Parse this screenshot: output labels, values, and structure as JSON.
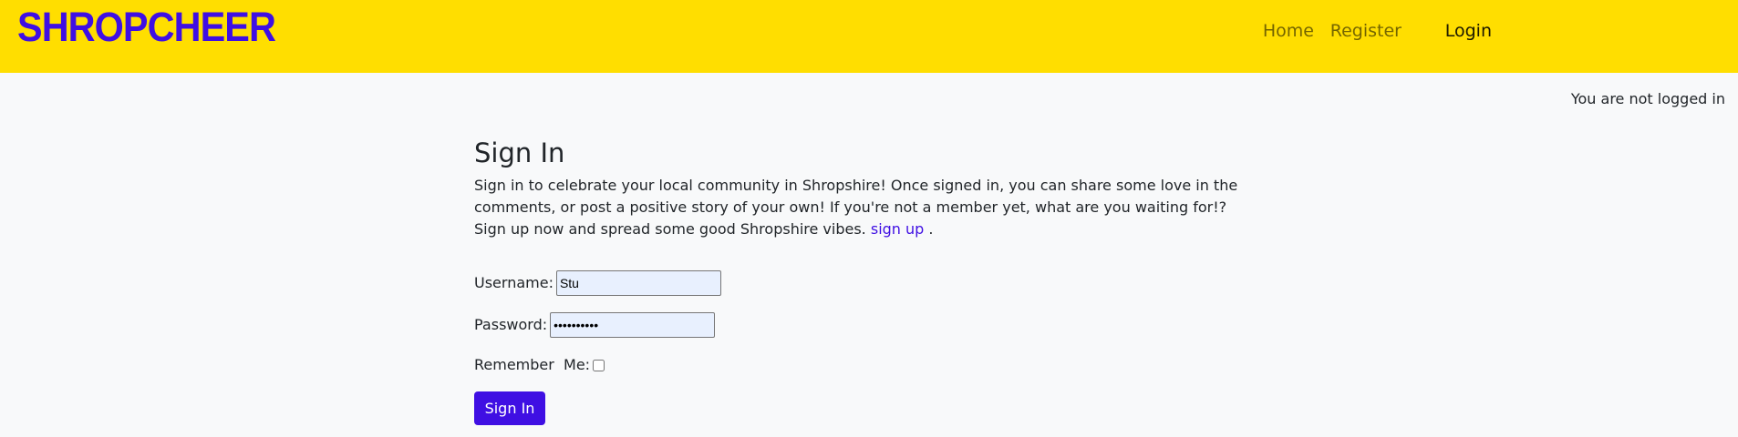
{
  "navbar": {
    "brand": "SHROPCHEER",
    "links": [
      {
        "label": "Home"
      },
      {
        "label": "Register"
      },
      {
        "label": "Login"
      }
    ]
  },
  "status_text": "You are not logged in",
  "signin": {
    "title": "Sign In",
    "intro_text": "Sign in to celebrate your local community in Shropshire! Once signed in, you can share some love in the comments, or post a positive story of your own!  If you're not a member yet, what are you waiting for!? Sign up now and spread some good Shropshire vibes.",
    "signup_link": "sign up",
    "signup_suffix": ".",
    "username_label": "Username:",
    "username_value": "Stu",
    "password_label": "Password:",
    "password_value": "••••••••••",
    "remember_label": "Remember  Me:",
    "submit_label": "Sign In"
  },
  "colors": {
    "navbar_bg": "#ffde00",
    "brand": "#3f0fe3",
    "button_bg": "#3f0fe3",
    "page_bg": "#f8f9fa"
  }
}
